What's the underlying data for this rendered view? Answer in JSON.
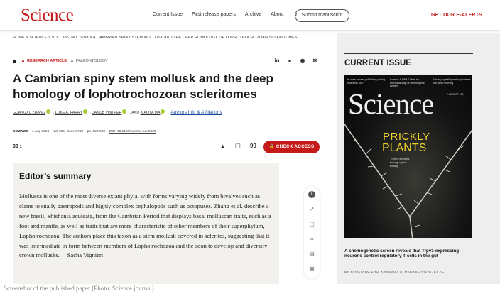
{
  "header": {
    "logo": "Science",
    "nav": [
      "Current Issue",
      "First release papers",
      "Archive",
      "About"
    ],
    "about_chevron": "∨",
    "submit_label": "Submit manuscript",
    "alerts_label": "GET OUR E-ALERTS"
  },
  "breadcrumb": "HOME  >  SCIENCE  >  VOL. 385, NO. 6708  >  A CAMBRIAN SPINY STEM MOLLUSK AND THE DEEP HOMOLOGY OF LOPHOTROCHOZOAN SCLERITOMES",
  "article": {
    "type_label": "RESEARCH ARTICLE",
    "category": "PALEONTOLOGY",
    "title": "A Cambrian spiny stem mollusk and the deep homology of lophotrochozoan scleritomes",
    "authors": [
      "GUANGXU ZHANG",
      "LUKE A. PARRY",
      "JAKOB VINTHER",
      "AND",
      "XIAOYA MA"
    ],
    "authors_info": "Authors Info & Affiliations",
    "citation": {
      "journal": "SCIENCE",
      "date": "1 Aug 2024",
      "volume": "Vol 385, Issue 6708",
      "pages": "pp. 528-532",
      "doi": "DOI: 10.1126/science.adn0059"
    },
    "cite_count_icon": "99",
    "cite_count": "1",
    "check_access_label": "CHECK ACCESS",
    "share_icons": [
      "linkedin-icon",
      "reddit-icon",
      "wechat-icon",
      "email-icon"
    ],
    "action_icons": [
      "bell-icon",
      "bookmark-icon",
      "quote-icon",
      "lock-icon"
    ]
  },
  "editor": {
    "heading": "Editor’s summary",
    "body": "Mollusca is one of the most diverse extant phyla, with forms varying widely from bivalves such as clams to snaily gastropods and highly complex cephalopods such as octopuses. Zhang et al. describe a new fossil, Shishania aculeata, from the Cambrian Period that displays basal molluscan traits, such as a foot and mantle, as well as traits that are more characteristic of other members of their superphylum, Lophotrochozoa. The authors place this taxon as a stem mollusk covered in sclerites, suggesting that it was intermediate in form between members of Lophotrochozoa and the soon to develop and diversify crown mollusks. —Sacha Vignieri"
  },
  "tools": [
    "info-icon",
    "trending-icon",
    "lock-icon",
    "link-icon",
    "document-icon",
    "table-icon"
  ],
  "sidebar": {
    "heading": "CURRENT ISSUE",
    "cover": {
      "top_items": [
        "Is open-access publishing pricing scientists out?",
        "Science & PNAS Prize for functional map of interoceptive system",
        "Solving crystallographic problems with deep learning"
      ],
      "logo": "Science",
      "date": "2 AUGUST 2024",
      "headline_1": "PRICKLY",
      "headline_2": "PLANTS",
      "sub": "Thorns evolved through gene editing"
    },
    "headline": "A chemogenetic screen reveals that Trpv1-expressing neurons control regulatory T cells in the gut",
    "byline": "BY YANGYANG ZHU, KIMBERLY A. MEERSCHAERT, ET AL."
  },
  "caption": "Screenshot of the published paper (Photo: Science journal)",
  "colors": {
    "brand_red": "#c41a1a",
    "link_blue": "#1f4fa0",
    "orcid_green": "#a6ce39",
    "cover_yellow": "#f3d22a"
  }
}
